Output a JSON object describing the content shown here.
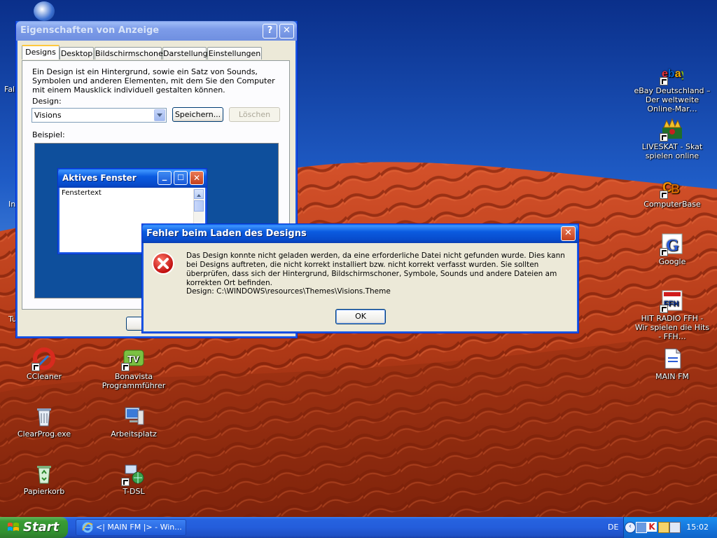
{
  "desktop": {
    "icons_right": [
      {
        "label": "eBay Deutschland – Der weltweite Online-Mar…",
        "icon": "ebay-icon"
      },
      {
        "label": "LIVESKAT - Skat spielen online",
        "icon": "liveskat-icon"
      },
      {
        "label": "ComputerBase",
        "icon": "computerbase-icon"
      },
      {
        "label": "Google",
        "icon": "google-icon"
      },
      {
        "label": "HIT RADIO FFH - Wir spielen die Hits - FFH…",
        "icon": "ffh-radio-icon"
      },
      {
        "label": "MAIN FM",
        "icon": "document-icon"
      }
    ],
    "icons_left": [
      {
        "label": "CCleaner",
        "icon": "ccleaner-icon"
      },
      {
        "label": "ClearProg.exe",
        "icon": "recycle-icon"
      },
      {
        "label": "Papierkorb",
        "icon": "recycle-bin-icon"
      },
      {
        "label": "Bonavista Programmführer",
        "icon": "tv-icon"
      },
      {
        "label": "Arbeitsplatz",
        "icon": "computer-icon"
      },
      {
        "label": "T-DSL",
        "icon": "network-icon"
      }
    ],
    "partial_labels": [
      "Fall",
      "In",
      "Tu"
    ]
  },
  "props_window": {
    "title": "Eigenschaften von Anzeige",
    "tabs": [
      "Designs",
      "Desktop",
      "Bildschirmschoner",
      "Darstellung",
      "Einstellungen"
    ],
    "description": "Ein Design ist ein Hintergrund, sowie ein Satz von Sounds, Symbolen und anderen Elementen, mit dem Sie den Computer mit einem Mausklick individuell gestalten können.",
    "design_label": "Design:",
    "design_value": "Visions",
    "save_label": "Speichern...",
    "delete_label": "Löschen",
    "example_label": "Beispiel:",
    "preview_window_title": "Aktives Fenster",
    "preview_window_text": "Fenstertext"
  },
  "error_dialog": {
    "title": "Fehler beim Laden des Designs",
    "message": "Das Design konnte nicht geladen werden, da eine erforderliche Datei nicht gefunden wurde. Dies kann bei Designs auftreten, die nicht korrekt installiert bzw. nicht korrekt verfasst wurden. Sie sollten überprüfen, dass sich der Hintergrund, Bildschirmschoner, Symbole, Sounds und andere Dateien am korrekten Ort befinden.",
    "path": "Design: C:\\WINDOWS\\resources\\Themes\\Visions.Theme",
    "ok_label": "OK"
  },
  "taskbar": {
    "start_label": "Start",
    "task_item": "<| MAIN FM |> - Win...",
    "language": "DE",
    "clock": "15:02"
  }
}
